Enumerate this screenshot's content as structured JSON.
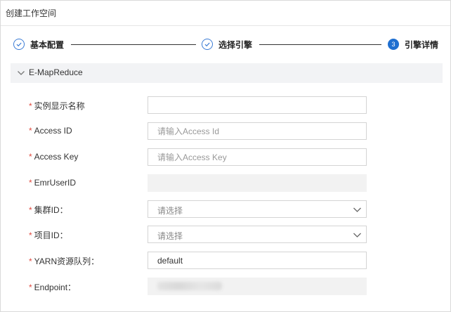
{
  "dialog": {
    "title": "创建工作空间"
  },
  "steps": [
    {
      "label": "基本配置",
      "state": "done"
    },
    {
      "label": "选择引擎",
      "state": "done"
    },
    {
      "number": "3",
      "label": "引擎详情",
      "state": "active"
    }
  ],
  "section": {
    "title": "E-MapReduce",
    "icon": "chevron-down-icon"
  },
  "form": {
    "instance_name": {
      "label": "实例显示名称",
      "value": ""
    },
    "access_id": {
      "label": "Access ID",
      "placeholder": "请输入Access Id"
    },
    "access_key": {
      "label": "Access Key",
      "placeholder": "请输入Access Key"
    },
    "emr_user_id": {
      "label": "EmrUserID",
      "value": ""
    },
    "cluster_id": {
      "label": "集群ID：",
      "selected": "请选择"
    },
    "project_id": {
      "label": "项目ID：",
      "selected": "请选择"
    },
    "yarn_queue": {
      "label": "YARN资源队列：",
      "value": "default"
    },
    "endpoint": {
      "label": "Endpoint："
    }
  },
  "colors": {
    "accent": "#1f6fd0",
    "required": "#e04a3f",
    "section_bg": "#f2f3f5"
  }
}
